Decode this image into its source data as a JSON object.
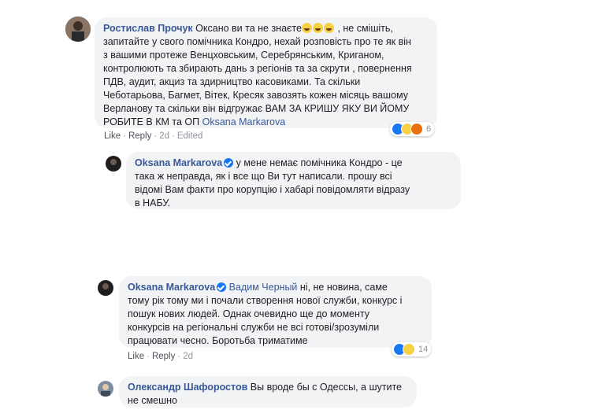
{
  "comments": [
    {
      "author": "Ростислав Прочук",
      "lines": [
        {
          "text": "Оксано ви та не знаєте",
          "emoji_after": 3,
          "after": ", не смішіть,"
        },
        {
          "text": "запитайте у свого помічника Кондро, нехай розповість про те як він"
        },
        {
          "text": "з вашими протеже Венцховським, Серебрянським, Криганом,"
        },
        {
          "text": "контролюють та збирають дань з регіонів та за скрути , повернення"
        },
        {
          "text": "ПДВ, аудит, акциз та здирництво касовиками. Та скільки"
        },
        {
          "text": "Чеботарьова, Багмет, Вітек, Кресяк завозять кожен місяць вашому"
        },
        {
          "text": "Верланову та скільки він відгружає ВАМ ЗА КРИШУ ЯКУ ВИ ЙОМУ"
        },
        {
          "text": "РОБИТЕ В КМ та ОП ",
          "tag": "Oksana Markarova"
        }
      ],
      "actions": {
        "like": "Like",
        "reply": "Reply",
        "time": "2d",
        "edited": "Edited"
      },
      "reactions": {
        "types": [
          "like",
          "haha",
          "angry"
        ],
        "count": "6"
      }
    },
    {
      "author": "Oksana Markarova",
      "verified": true,
      "lines": [
        {
          "text": "у мене немає помічника Кондро - це"
        },
        {
          "text": "така ж неправда, як і все що Ви тут написали. прошу всі"
        },
        {
          "text": "відомі Вам факти про корупцію і хабарі повідомляти відразу"
        },
        {
          "text": "в НАБУ."
        }
      ]
    },
    {
      "author": "Oksana Markarova",
      "verified": true,
      "tag": "Вадим Черный",
      "lines": [
        {
          "text": "ні, не новина, саме"
        },
        {
          "text": "тому рік тому ми і почали створення нової служби, конкурс і"
        },
        {
          "text": "пошук нових людей. Однак очевидно ще до моменту"
        },
        {
          "text": "конкурсів на регіональні служби не всі готові/зрозуміли"
        },
        {
          "text": "працювати чесно. Боротьба триматиме"
        }
      ],
      "actions": {
        "like": "Like",
        "reply": "Reply",
        "time": "2d"
      },
      "reactions": {
        "types": [
          "like",
          "wow"
        ],
        "count": "14"
      }
    },
    {
      "author": "Олександр Шафоростов",
      "lines": [
        {
          "text": "Вы вроде бы с Одессы, а шутите"
        },
        {
          "text": "не смешно"
        }
      ]
    }
  ],
  "icons": {
    "verified": "verified-badge-icon",
    "like": "like-reaction-icon",
    "haha": "haha-reaction-icon",
    "angry": "angry-reaction-icon",
    "wow": "wow-reaction-icon"
  },
  "colors": {
    "link": "#385898",
    "bubble": "#f2f3f5",
    "meta": "#90949c",
    "like_blue": "#1877f2"
  }
}
